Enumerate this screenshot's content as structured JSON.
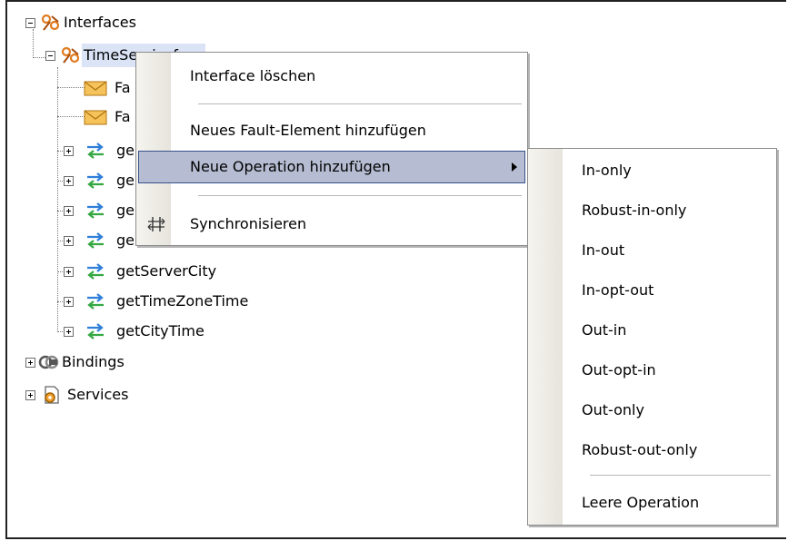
{
  "tree": {
    "interfaces": "Interfaces",
    "selected_interface": "TimeServiceface",
    "faults": [
      "Fa",
      "Fa"
    ],
    "ops_truncated": [
      "ge",
      "ge",
      "ge",
      "ge"
    ],
    "ops": [
      "getServerCity",
      "getTimeZoneTime",
      "getCityTime"
    ],
    "bindings": "Bindings",
    "services": "Services"
  },
  "context_menu": {
    "items": [
      "Interface löschen",
      "Neues Fault-Element hinzufügen",
      "Neue Operation hinzufügen",
      "Synchronisieren"
    ],
    "highlighted": "Neue Operation hinzufügen"
  },
  "submenu": {
    "items": [
      "In-only",
      "Robust-in-only",
      "In-out",
      "In-opt-out",
      "Out-in",
      "Out-opt-in",
      "Out-only",
      "Robust-out-only"
    ],
    "footer": "Leere Operation"
  },
  "colors": {
    "highlight_bg": "#b6bdd2",
    "highlight_border": "#37518c",
    "arrow_blue": "#2f7fd9",
    "arrow_green": "#35a843",
    "interface_orange": "#e07b1f"
  }
}
